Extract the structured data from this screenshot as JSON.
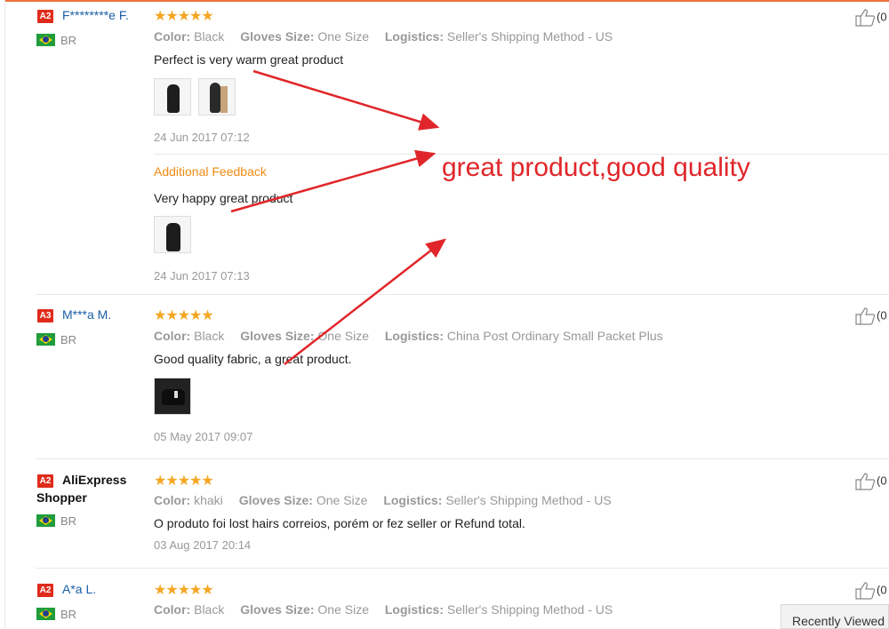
{
  "reviews": [
    {
      "badge": "A2",
      "name": "F********e F.",
      "country": "BR",
      "stars": "★★★★★",
      "color_label": "Color:",
      "color": "Black",
      "size_label": "Gloves Size:",
      "size": "One Size",
      "logistics_label": "Logistics:",
      "logistics": "Seller's Shipping Method - US",
      "text": "Perfect is very warm great product",
      "date": "24 Jun 2017 07:12",
      "additional_title": "Additional Feedback",
      "additional_text": "Very happy great product",
      "additional_date": "24 Jun 2017 07:13",
      "likes": "(0"
    },
    {
      "badge": "A3",
      "name": "M***a M.",
      "country": "BR",
      "stars": "★★★★★",
      "color_label": "Color:",
      "color": "Black",
      "size_label": "Gloves Size:",
      "size": "One Size",
      "logistics_label": "Logistics:",
      "logistics": "China Post Ordinary Small Packet Plus",
      "text": "Good quality fabric, a great product.",
      "date": "05 May 2017 09:07",
      "likes": "(0"
    },
    {
      "badge": "A2",
      "name": "AliExpress Shopper",
      "country": "BR",
      "stars": "★★★★★",
      "color_label": "Color:",
      "color": "khaki",
      "size_label": "Gloves Size:",
      "size": "One Size",
      "logistics_label": "Logistics:",
      "logistics": "Seller's Shipping Method - US",
      "text": "O produto foi lost hairs correios, porém or fez seller or Refund total.",
      "date": "03 Aug 2017 20:14",
      "likes": "(0"
    },
    {
      "badge": "A2",
      "name": "A*a L.",
      "country": "BR",
      "stars": "★★★★★",
      "color_label": "Color:",
      "color": "Black",
      "size_label": "Gloves Size:",
      "size": "One Size",
      "logistics_label": "Logistics:",
      "logistics": "Seller's Shipping Method - US",
      "likes": "(0"
    }
  ],
  "overlay_text": "great product,good quality",
  "recently_viewed": "Recently Viewed",
  "colors": {
    "accent": "#ef6f3c",
    "badge": "#e02b1b",
    "link": "#1a5fa8",
    "stars": "#f5a623",
    "annotation": "#e0262a",
    "additional": "#f08a12"
  }
}
